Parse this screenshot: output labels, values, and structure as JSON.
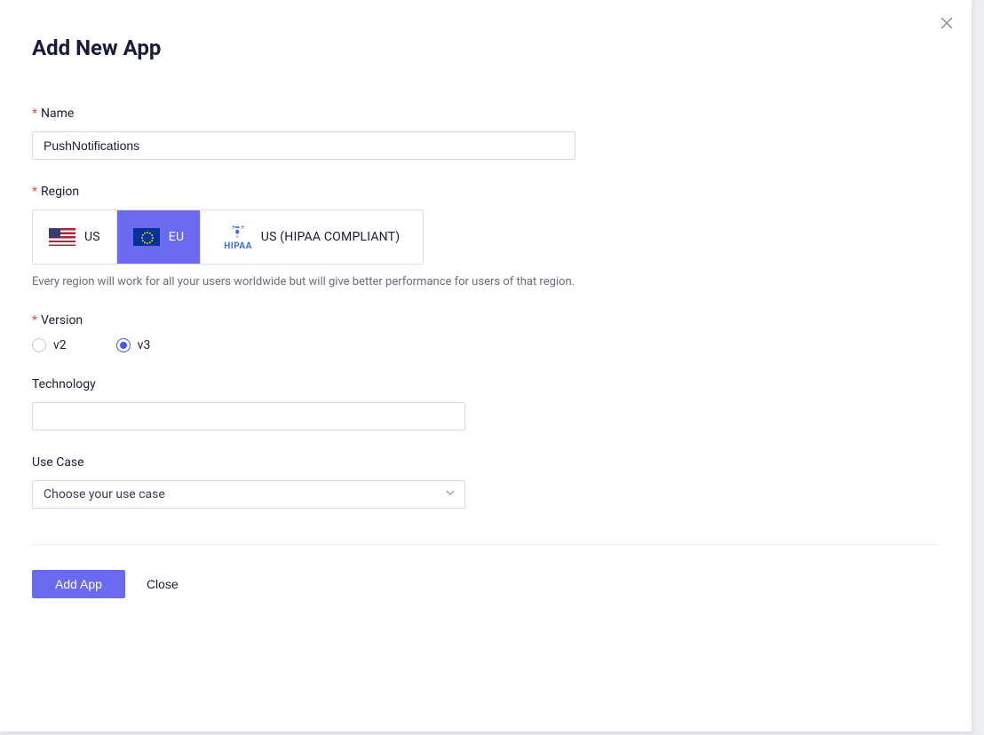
{
  "title": "Add New App",
  "fields": {
    "name": {
      "label": "Name",
      "required": true,
      "value": "PushNotifications"
    },
    "region": {
      "label": "Region",
      "required": true,
      "options": {
        "us": "US",
        "eu": "EU",
        "hipaa": "US (HIPAA COMPLIANT)",
        "hipaa_tag": "HIPAA"
      },
      "selected": "eu",
      "helper": "Every region will work for all your users worldwide but will give better performance for users of that region."
    },
    "version": {
      "label": "Version",
      "required": true,
      "options": {
        "v2": "v2",
        "v3": "v3"
      },
      "selected": "v3"
    },
    "technology": {
      "label": "Technology",
      "required": false,
      "value": ""
    },
    "useCase": {
      "label": "Use Case",
      "required": false,
      "placeholder": "Choose your use case"
    }
  },
  "buttons": {
    "primary": "Add App",
    "close": "Close"
  }
}
